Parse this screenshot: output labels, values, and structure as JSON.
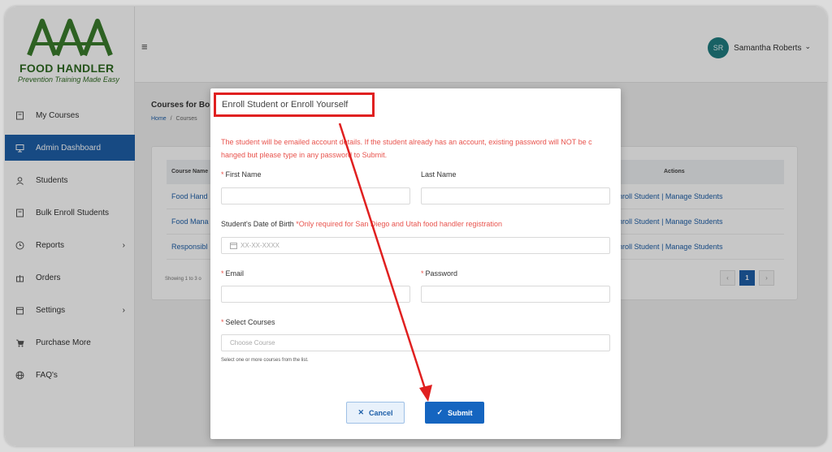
{
  "brand": {
    "name": "FOOD HANDLER",
    "tagline": "Prevention Training Made Easy",
    "logo_letters": "AAA"
  },
  "sidebar": {
    "items": [
      {
        "label": "My Courses",
        "icon": "book-icon",
        "active": false,
        "chevron": false
      },
      {
        "label": "Admin Dashboard",
        "icon": "dashboard-icon",
        "active": true,
        "chevron": false
      },
      {
        "label": "Students",
        "icon": "user-icon",
        "active": false,
        "chevron": false
      },
      {
        "label": "Bulk Enroll Students",
        "icon": "book-icon",
        "active": false,
        "chevron": false
      },
      {
        "label": "Reports",
        "icon": "clock-icon",
        "active": false,
        "chevron": true
      },
      {
        "label": "Orders",
        "icon": "gift-icon",
        "active": false,
        "chevron": false
      },
      {
        "label": "Settings",
        "icon": "calendar-icon",
        "active": false,
        "chevron": true
      },
      {
        "label": "Purchase More",
        "icon": "cart-icon",
        "active": false,
        "chevron": false
      },
      {
        "label": "FAQ's",
        "icon": "globe-icon",
        "active": false,
        "chevron": false
      }
    ],
    "chevron_glyph": "›"
  },
  "header": {
    "menu_glyph": "≡",
    "user_initials": "SR",
    "user_name": "Samantha Roberts",
    "caret": "⌄"
  },
  "page": {
    "title": "Courses for Bo",
    "breadcrumb": {
      "home": "Home",
      "sep": "/",
      "current": "Courses"
    },
    "table": {
      "col_course": "Course Name",
      "col_actions": "Actions",
      "rows": [
        {
          "name": "Food Hand",
          "enroll": "nroll Student",
          "sep": "|",
          "manage": "Manage Students"
        },
        {
          "name": "Food Mana",
          "enroll": "nroll Student",
          "sep": "|",
          "manage": "Manage Students"
        },
        {
          "name": "Responsibl",
          "enroll": "nroll Student",
          "sep": "|",
          "manage": "Manage Students"
        }
      ],
      "showing": "Showing 1 to 3 o",
      "pager": {
        "prev": "‹",
        "current": "1",
        "next": "›"
      }
    }
  },
  "modal": {
    "title": "Enroll Student or Enroll Yourself",
    "notice": "The student will be emailed account details. If the student already has an account, existing password will NOT be c hanged but please type in any password to Submit.",
    "first_name_label": "First Name",
    "last_name_label": "Last Name",
    "dob_label": "Student's Date of Birth",
    "dob_note": "*Only required for San Diego and Utah food handler registration",
    "dob_placeholder": "XX-XX-XXXX",
    "email_label": "Email",
    "password_label": "Password",
    "courses_label": "Select Courses",
    "courses_placeholder": "Choose Course",
    "courses_helper": "Select one or more courses from the list.",
    "required_mark": "*",
    "cancel_label": "Cancel",
    "submit_label": "Submit",
    "cancel_glyph": "✕",
    "submit_glyph": "✓"
  },
  "colors": {
    "accent": "#1e5fa8",
    "annotation": "#e02020",
    "brand_green": "#2f6b22",
    "required": "#e8534d"
  }
}
